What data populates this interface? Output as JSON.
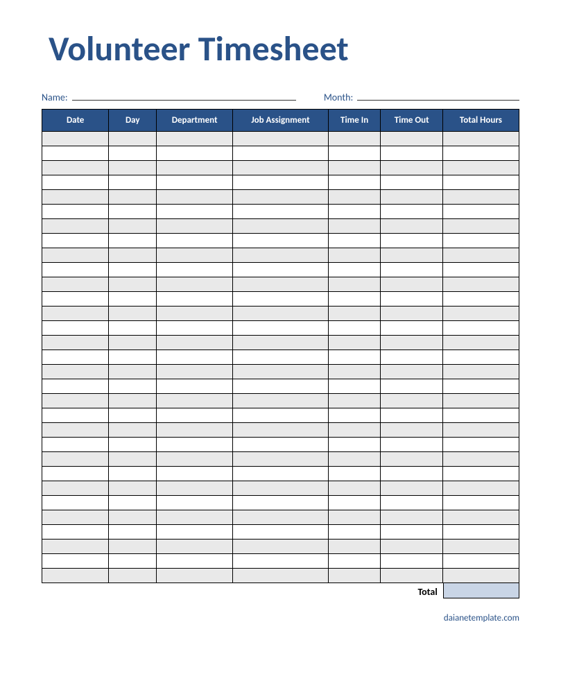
{
  "title": "Volunteer Timesheet",
  "fields": {
    "name_label": "Name:",
    "month_label": "Month:",
    "name_value": "",
    "month_value": ""
  },
  "table": {
    "headers": [
      "Date",
      "Day",
      "Department",
      "Job Assignment",
      "Time In",
      "Time Out",
      "Total Hours"
    ],
    "row_count": 31,
    "total_label": "Total",
    "total_value": ""
  },
  "footer": "daianetemplate.com",
  "colors": {
    "accent": "#2a5288",
    "row_alt": "#e9e9e9",
    "total_bg": "#c9d5e6"
  }
}
